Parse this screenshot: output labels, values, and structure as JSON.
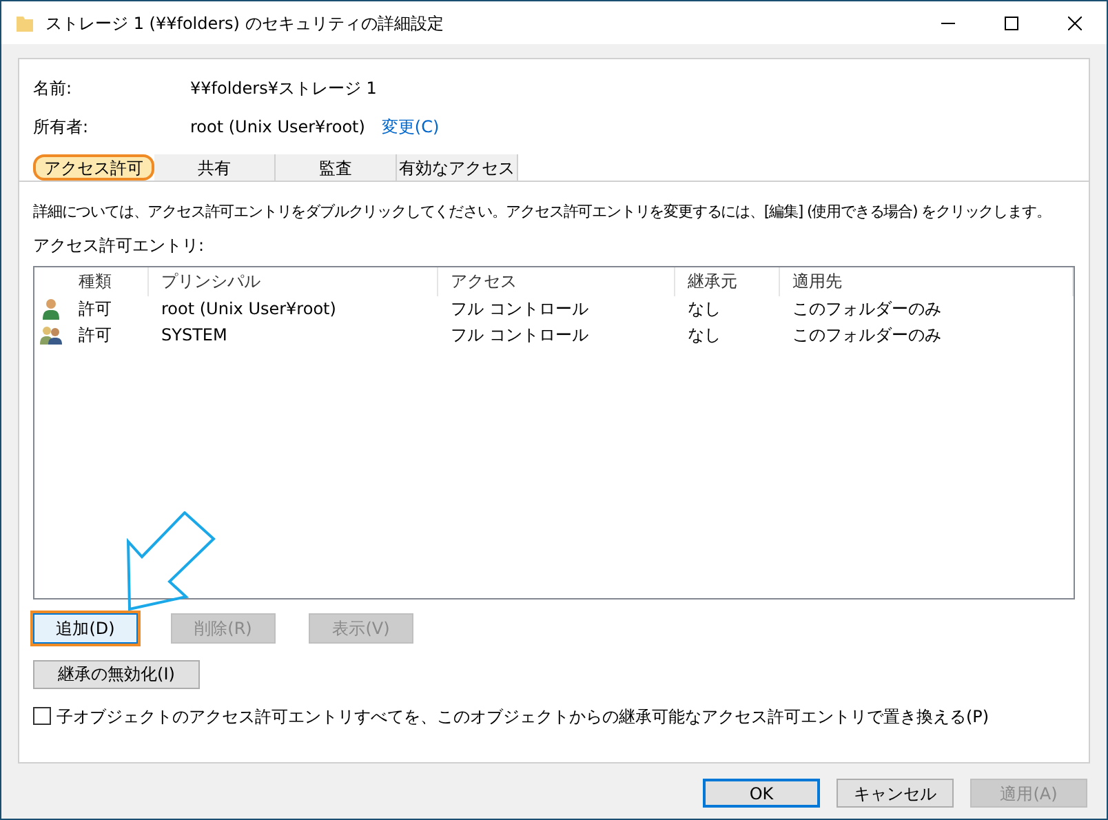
{
  "window": {
    "title": "ストレージ 1 (¥¥folders) のセキュリティの詳細設定"
  },
  "info": [
    {
      "label": "名前:",
      "value": "¥¥folders¥ストレージ 1"
    },
    {
      "label": "所有者:",
      "value": "root (Unix User¥root)",
      "link": "変更(C)"
    }
  ],
  "tabs": [
    {
      "label": "アクセス許可",
      "selected": true,
      "highlighted": true
    },
    {
      "label": "共有",
      "selected": false,
      "highlighted": false
    },
    {
      "label": "監査",
      "selected": false,
      "highlighted": false
    },
    {
      "label": "有効なアクセス",
      "selected": false,
      "highlighted": false
    }
  ],
  "description": "詳細については、アクセス許可エントリをダブルクリックしてください。アクセス許可エントリを変更するには、[編集] (使用できる場合) をクリックします。",
  "entries_label": "アクセス許可エントリ:",
  "table": {
    "columns": [
      "種類",
      "プリンシパル",
      "アクセス",
      "継承元",
      "適用先"
    ],
    "rows": [
      {
        "kind": "user",
        "cells": [
          "許可",
          "root (Unix User¥root)",
          "フル コントロール",
          "なし",
          "このフォルダーのみ"
        ]
      },
      {
        "kind": "group",
        "cells": [
          "許可",
          "SYSTEM",
          "フル コントロール",
          "なし",
          "このフォルダーのみ"
        ]
      }
    ]
  },
  "entry_buttons": [
    {
      "label": "追加(D)",
      "disabled": false,
      "highlighted": true
    },
    {
      "label": "削除(R)",
      "disabled": true,
      "highlighted": false
    },
    {
      "label": "表示(V)",
      "disabled": true,
      "highlighted": false
    }
  ],
  "inheritance_button": {
    "label": "継承の無効化(I)"
  },
  "replace_checkbox": {
    "label": "子オブジェクトのアクセス許可エントリすべてを、このオブジェクトからの継承可能なアクセス許可エントリで置き換える(P)",
    "checked": false
  },
  "footer_buttons": [
    {
      "label": "OK",
      "disabled": false,
      "default": true
    },
    {
      "label": "キャンセル",
      "disabled": false,
      "default": false
    },
    {
      "label": "適用(A)",
      "disabled": true,
      "default": false
    }
  ]
}
